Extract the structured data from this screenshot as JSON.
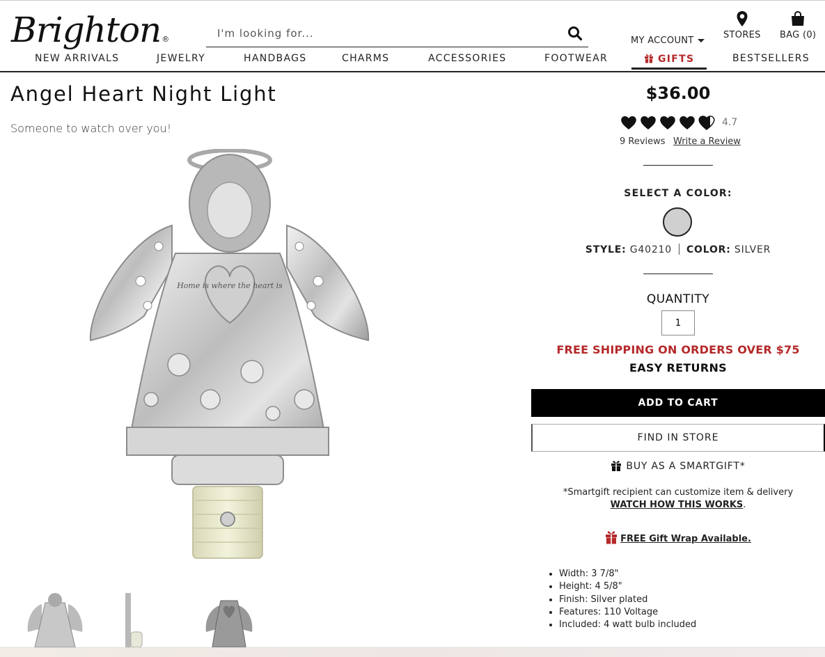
{
  "header": {
    "logo": "Brighton",
    "logo_mark": "®",
    "search_placeholder": "I'm looking for...",
    "account_label": "MY ACCOUNT",
    "stores_label": "STORES",
    "bag_label": "BAG (0)"
  },
  "nav": {
    "items": [
      "NEW ARRIVALS",
      "JEWELRY",
      "HANDBAGS",
      "CHARMS",
      "ACCESSORIES",
      "FOOTWEAR",
      "GIFTS",
      "BESTSELLERS"
    ]
  },
  "colors": {
    "accent_red": "#b5292a",
    "button_black": "#000000",
    "swatch_silver": "#d0d0d0"
  },
  "product": {
    "title": "Angel Heart Night Light",
    "tagline": "Someone to watch over you!",
    "price": "$36.00",
    "rating_value": 4.7,
    "rating_text": "4.7",
    "reviews_count": "9 Reviews",
    "write_review": "Write a Review",
    "select_color_label": "SELECT A COLOR:",
    "style_label": "STYLE:",
    "style_value": "G40210",
    "color_label": "COLOR:",
    "color_value": "SILVER",
    "quantity_label": "QUANTITY",
    "quantity_value": "1",
    "shipping_text": "FREE SHIPPING ON ORDERS OVER $75",
    "returns_text": "EASY RETURNS",
    "add_to_cart": "ADD TO CART",
    "find_in_store": "FIND IN STORE",
    "smartgift_label": "BUY AS A SMARTGIFT*",
    "smartgift_note": "*Smartgift recipient can customize item & delivery",
    "watch_link": "WATCH HOW THIS WORKS",
    "watch_suffix": ".",
    "giftwrap_link": "FREE Gift Wrap Available.",
    "heart_text": "Home is where the heart is",
    "specs": [
      "Width: 3 7/8\"",
      "Height: 4 5/8\"",
      "Finish: Silver plated",
      "Features: 110 Voltage",
      "Included: 4 watt bulb included"
    ]
  },
  "icons": {
    "search": "search-icon",
    "location": "location-pin-icon",
    "bag": "shopping-bag-icon",
    "gift": "gift-icon",
    "heart_rating": "heart-icon"
  }
}
